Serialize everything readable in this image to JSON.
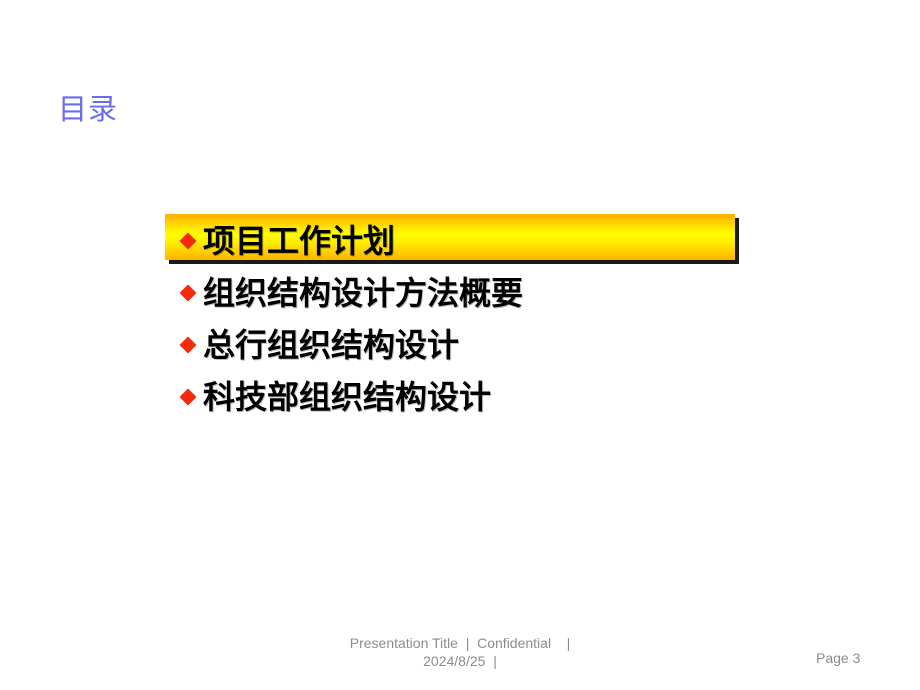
{
  "slide": {
    "title": "目录",
    "toc": [
      {
        "label": "项目工作计划",
        "highlighted": true
      },
      {
        "label": "组织结构设计方法概要",
        "highlighted": false
      },
      {
        "label": "总行组织结构设计",
        "highlighted": false
      },
      {
        "label": "科技部组织结构设计",
        "highlighted": false
      }
    ],
    "bullet_icon": "red-diamond",
    "colors": {
      "title": "#6a6cf0",
      "bullet": "#f42a0c",
      "highlight_center": "#ffff00",
      "highlight_edge": "#ffb000"
    }
  },
  "footer": {
    "line1": "Presentation Title  |  Confidential    |",
    "line2": "2024/8/25  |",
    "page": "Page 3"
  }
}
